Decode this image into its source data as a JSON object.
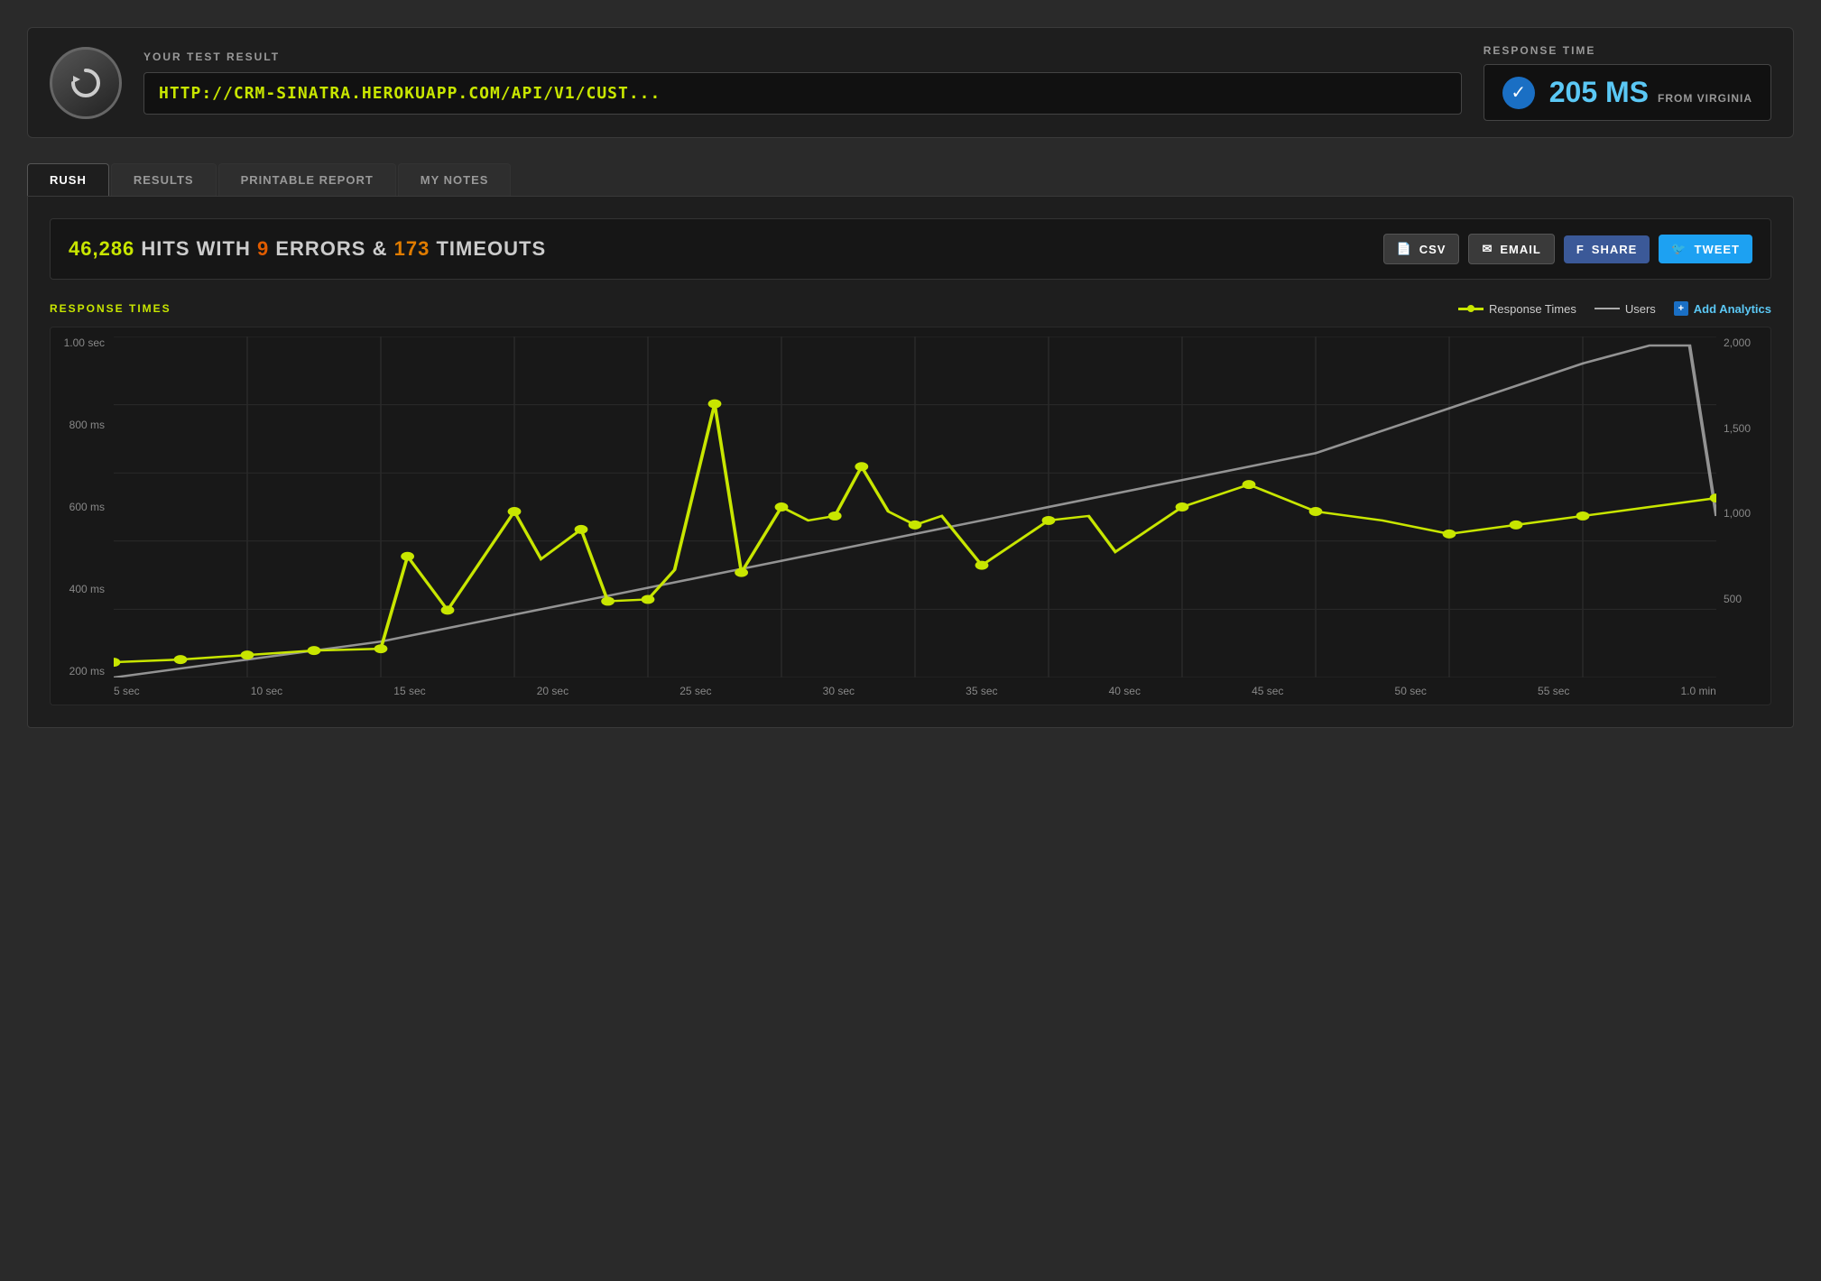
{
  "header": {
    "your_test_result_label": "YOUR TEST RESULT",
    "response_time_label": "RESPONSE TIME",
    "url": "HTTP://CRM-SINATRA.HEROKUAPP.COM/API/V1/CUST...",
    "response_ms": "205 MS",
    "from_location": "FROM VIRGINIA"
  },
  "tabs": [
    {
      "id": "rush",
      "label": "RUSH",
      "active": true
    },
    {
      "id": "results",
      "label": "RESULTS",
      "active": false
    },
    {
      "id": "printable",
      "label": "PRINTABLE REPORT",
      "active": false
    },
    {
      "id": "notes",
      "label": "MY NOTES",
      "active": false
    }
  ],
  "stats": {
    "hits": "46,286",
    "hits_label": "HITS WITH",
    "errors": "9",
    "errors_label": "ERRORS &",
    "timeouts": "173",
    "timeouts_label": "TIMEOUTS"
  },
  "buttons": {
    "csv": "CSV",
    "email": "EMAIL",
    "share": "SHARE",
    "tweet": "TWEET"
  },
  "chart": {
    "title": "RESPONSE TIMES",
    "legend_response": "Response Times",
    "legend_users": "Users",
    "add_analytics": "Add Analytics",
    "y_left_labels": [
      "1.00 sec",
      "800 ms",
      "600 ms",
      "400 ms",
      "200 ms"
    ],
    "y_right_labels": [
      "2,000",
      "1,500",
      "1,000",
      "500"
    ],
    "x_labels": [
      "5 sec",
      "10 sec",
      "15 sec",
      "20 sec",
      "25 sec",
      "30 sec",
      "35 sec",
      "40 sec",
      "45 sec",
      "50 sec",
      "55 sec",
      "1.0 min"
    ]
  }
}
